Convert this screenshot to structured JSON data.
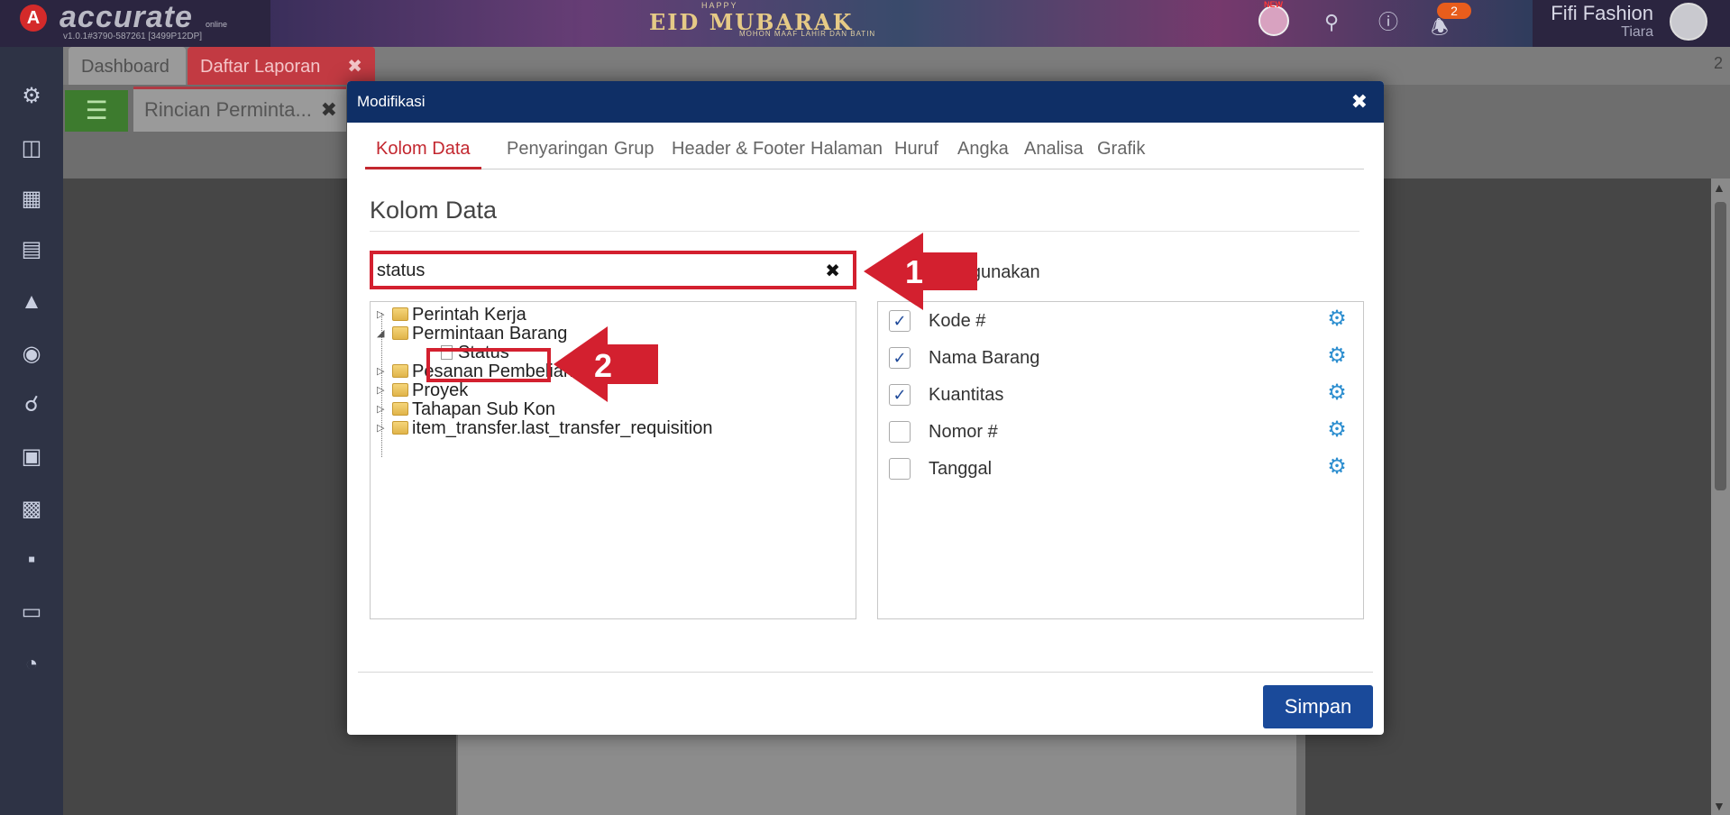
{
  "app": {
    "logo_letter": "A",
    "logo_text": "accurate",
    "logo_sub": "online",
    "version": "v1.0.1#3790-587261 [3499P12DP]",
    "banner_happy": "HAPPY",
    "banner_title": "EID MUBARAK",
    "banner_sub": "MOHON MAAF LAHIR DAN BATIN",
    "new_label": "NEW",
    "notification_count": "2",
    "company": "Fifi Fashion",
    "user": "Tiara",
    "tabs_right_number": "2"
  },
  "tabs": [
    {
      "label": "Dashboard"
    },
    {
      "label": "Daftar Laporan",
      "close": "✖"
    }
  ],
  "subtab": {
    "label": "Rincian Perminta...",
    "close": "✖"
  },
  "modal": {
    "title": "Modifikasi",
    "close": "✖",
    "tabs": [
      "Kolom Data",
      "Penyaringan",
      "Grup",
      "Header & Footer",
      "Halaman",
      "Huruf",
      "Angka",
      "Analisa",
      "Grafik"
    ],
    "section_title": "Kolom Data",
    "search_value": "status",
    "search_clear": "✖",
    "used_label": "Digunakan",
    "tree": [
      {
        "label": "Perintah Kerja"
      },
      {
        "label": "Permintaan Barang"
      },
      {
        "label": "Status"
      },
      {
        "label": "Pesanan Pembelian Terakhir"
      },
      {
        "label": "Proyek"
      },
      {
        "label": "Tahapan Sub Kon"
      },
      {
        "label": "item_transfer.last_transfer_requisition"
      }
    ],
    "columns": [
      {
        "label": "Kode #",
        "checked": true
      },
      {
        "label": "Nama Barang",
        "checked": true
      },
      {
        "label": "Kuantitas",
        "checked": true
      },
      {
        "label": "Nomor #",
        "checked": false
      },
      {
        "label": "Tanggal",
        "checked": false
      }
    ],
    "save_label": "Simpan"
  },
  "annotations": {
    "step1": "1",
    "step2": "2"
  },
  "colors": {
    "accent_red": "#d3202f",
    "header_blue": "#0f2f66",
    "save_blue": "#1a4a9a",
    "gear_blue": "#2e8fd0"
  }
}
